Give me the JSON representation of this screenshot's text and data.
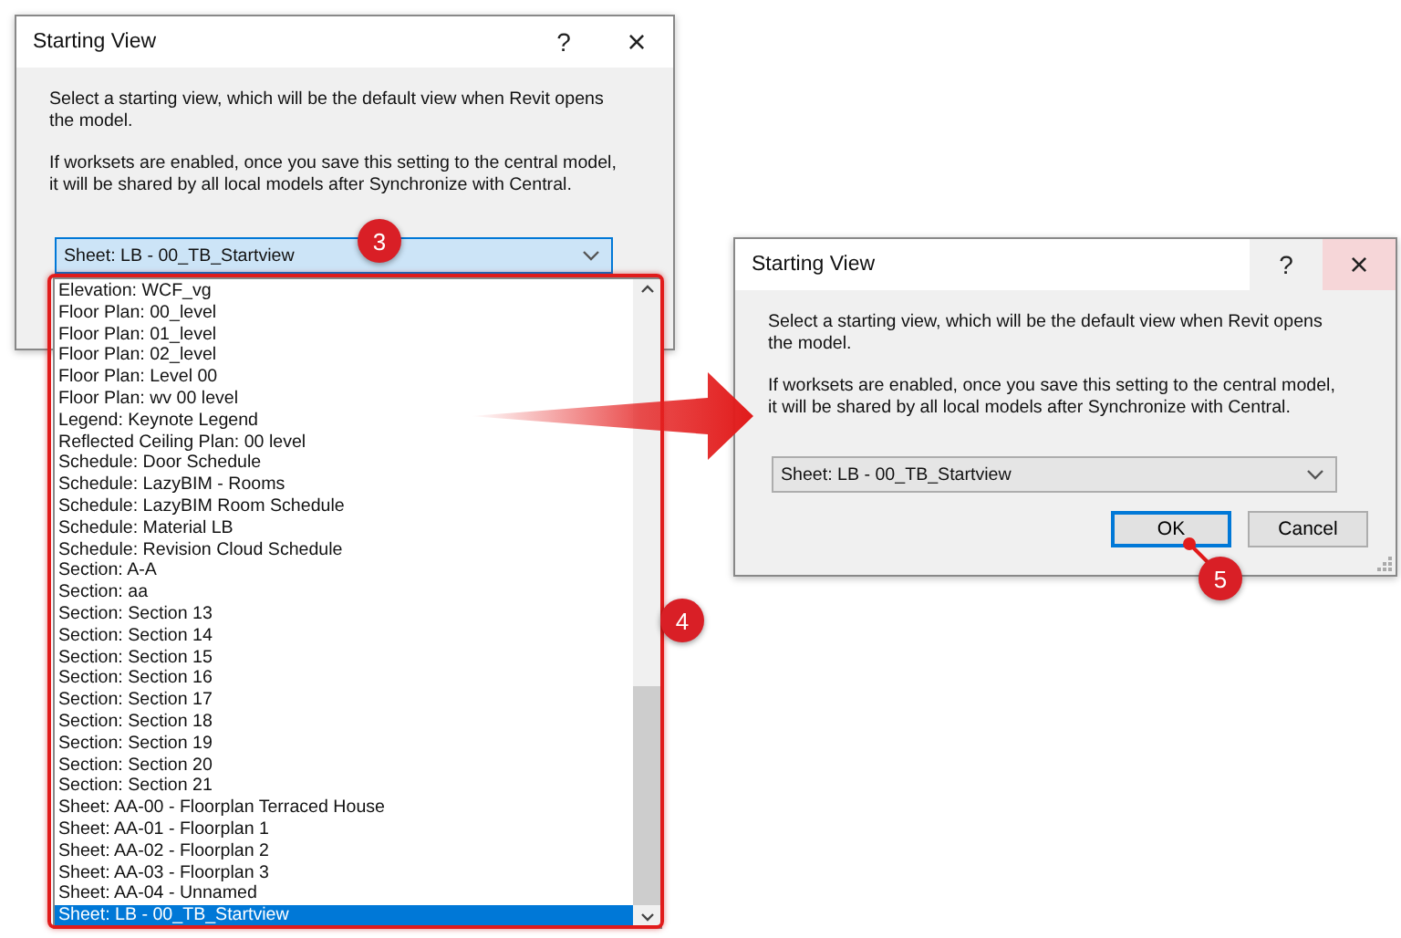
{
  "left_dialog": {
    "title": "Starting View",
    "help": "?",
    "close": "×",
    "close_hover": false,
    "paragraphs": [
      "Select a starting view, which will be the default view when Revit opens\nthe model.",
      "If worksets are enabled, once you save this setting to the central model,\nit will be shared by all local models after Synchronize with Central."
    ],
    "combo_value": "Sheet: LB - 00_TB_Startview",
    "list_items": [
      {
        "label": "Elevation: WCF_vg",
        "selected": false
      },
      {
        "label": "Floor Plan: 00_level",
        "selected": false
      },
      {
        "label": "Floor Plan: 01_level",
        "selected": false
      },
      {
        "label": "Floor Plan: 02_level",
        "selected": false
      },
      {
        "label": "Floor Plan: Level 00",
        "selected": false
      },
      {
        "label": "Floor Plan: wv 00 level",
        "selected": false
      },
      {
        "label": "Legend: Keynote Legend",
        "selected": false
      },
      {
        "label": "Reflected Ceiling Plan: 00 level",
        "selected": false
      },
      {
        "label": "Schedule: Door Schedule",
        "selected": false
      },
      {
        "label": "Schedule: LazyBIM - Rooms",
        "selected": false
      },
      {
        "label": "Schedule: LazyBIM Room Schedule",
        "selected": false
      },
      {
        "label": "Schedule: Material LB",
        "selected": false
      },
      {
        "label": "Schedule: Revision Cloud Schedule",
        "selected": false
      },
      {
        "label": "Section: A-A",
        "selected": false
      },
      {
        "label": "Section: aa",
        "selected": false
      },
      {
        "label": "Section: Section 13",
        "selected": false
      },
      {
        "label": "Section: Section 14",
        "selected": false
      },
      {
        "label": "Section: Section 15",
        "selected": false
      },
      {
        "label": "Section: Section 16",
        "selected": false
      },
      {
        "label": "Section: Section 17",
        "selected": false
      },
      {
        "label": "Section: Section 18",
        "selected": false
      },
      {
        "label": "Section: Section 19",
        "selected": false
      },
      {
        "label": "Section: Section 20",
        "selected": false
      },
      {
        "label": "Section: Section 21",
        "selected": false
      },
      {
        "label": "Sheet: AA-00 - Floorplan Terraced House",
        "selected": false
      },
      {
        "label": "Sheet: AA-01 - Floorplan 1",
        "selected": false
      },
      {
        "label": "Sheet: AA-02 - Floorplan 2",
        "selected": false
      },
      {
        "label": "Sheet: AA-03 - Floorplan 3",
        "selected": false
      },
      {
        "label": "Sheet: AA-04 - Unnamed",
        "selected": false
      },
      {
        "label": "Sheet: LB - 00_TB_Startview",
        "selected": true
      }
    ]
  },
  "right_dialog": {
    "title": "Starting View",
    "help": "?",
    "close": "×",
    "close_hover": true,
    "paragraphs": [
      "Select a starting view, which will be the default view when Revit opens\nthe model.",
      "If worksets are enabled, once you save this setting to the central model,\nit will be shared by all local models after Synchronize with Central."
    ],
    "combo_value": "Sheet: LB - 00_TB_Startview",
    "buttons": [
      {
        "label": "OK",
        "focused": true
      },
      {
        "label": "Cancel",
        "focused": false
      }
    ]
  },
  "callouts": [
    "3",
    "4",
    "5"
  ]
}
